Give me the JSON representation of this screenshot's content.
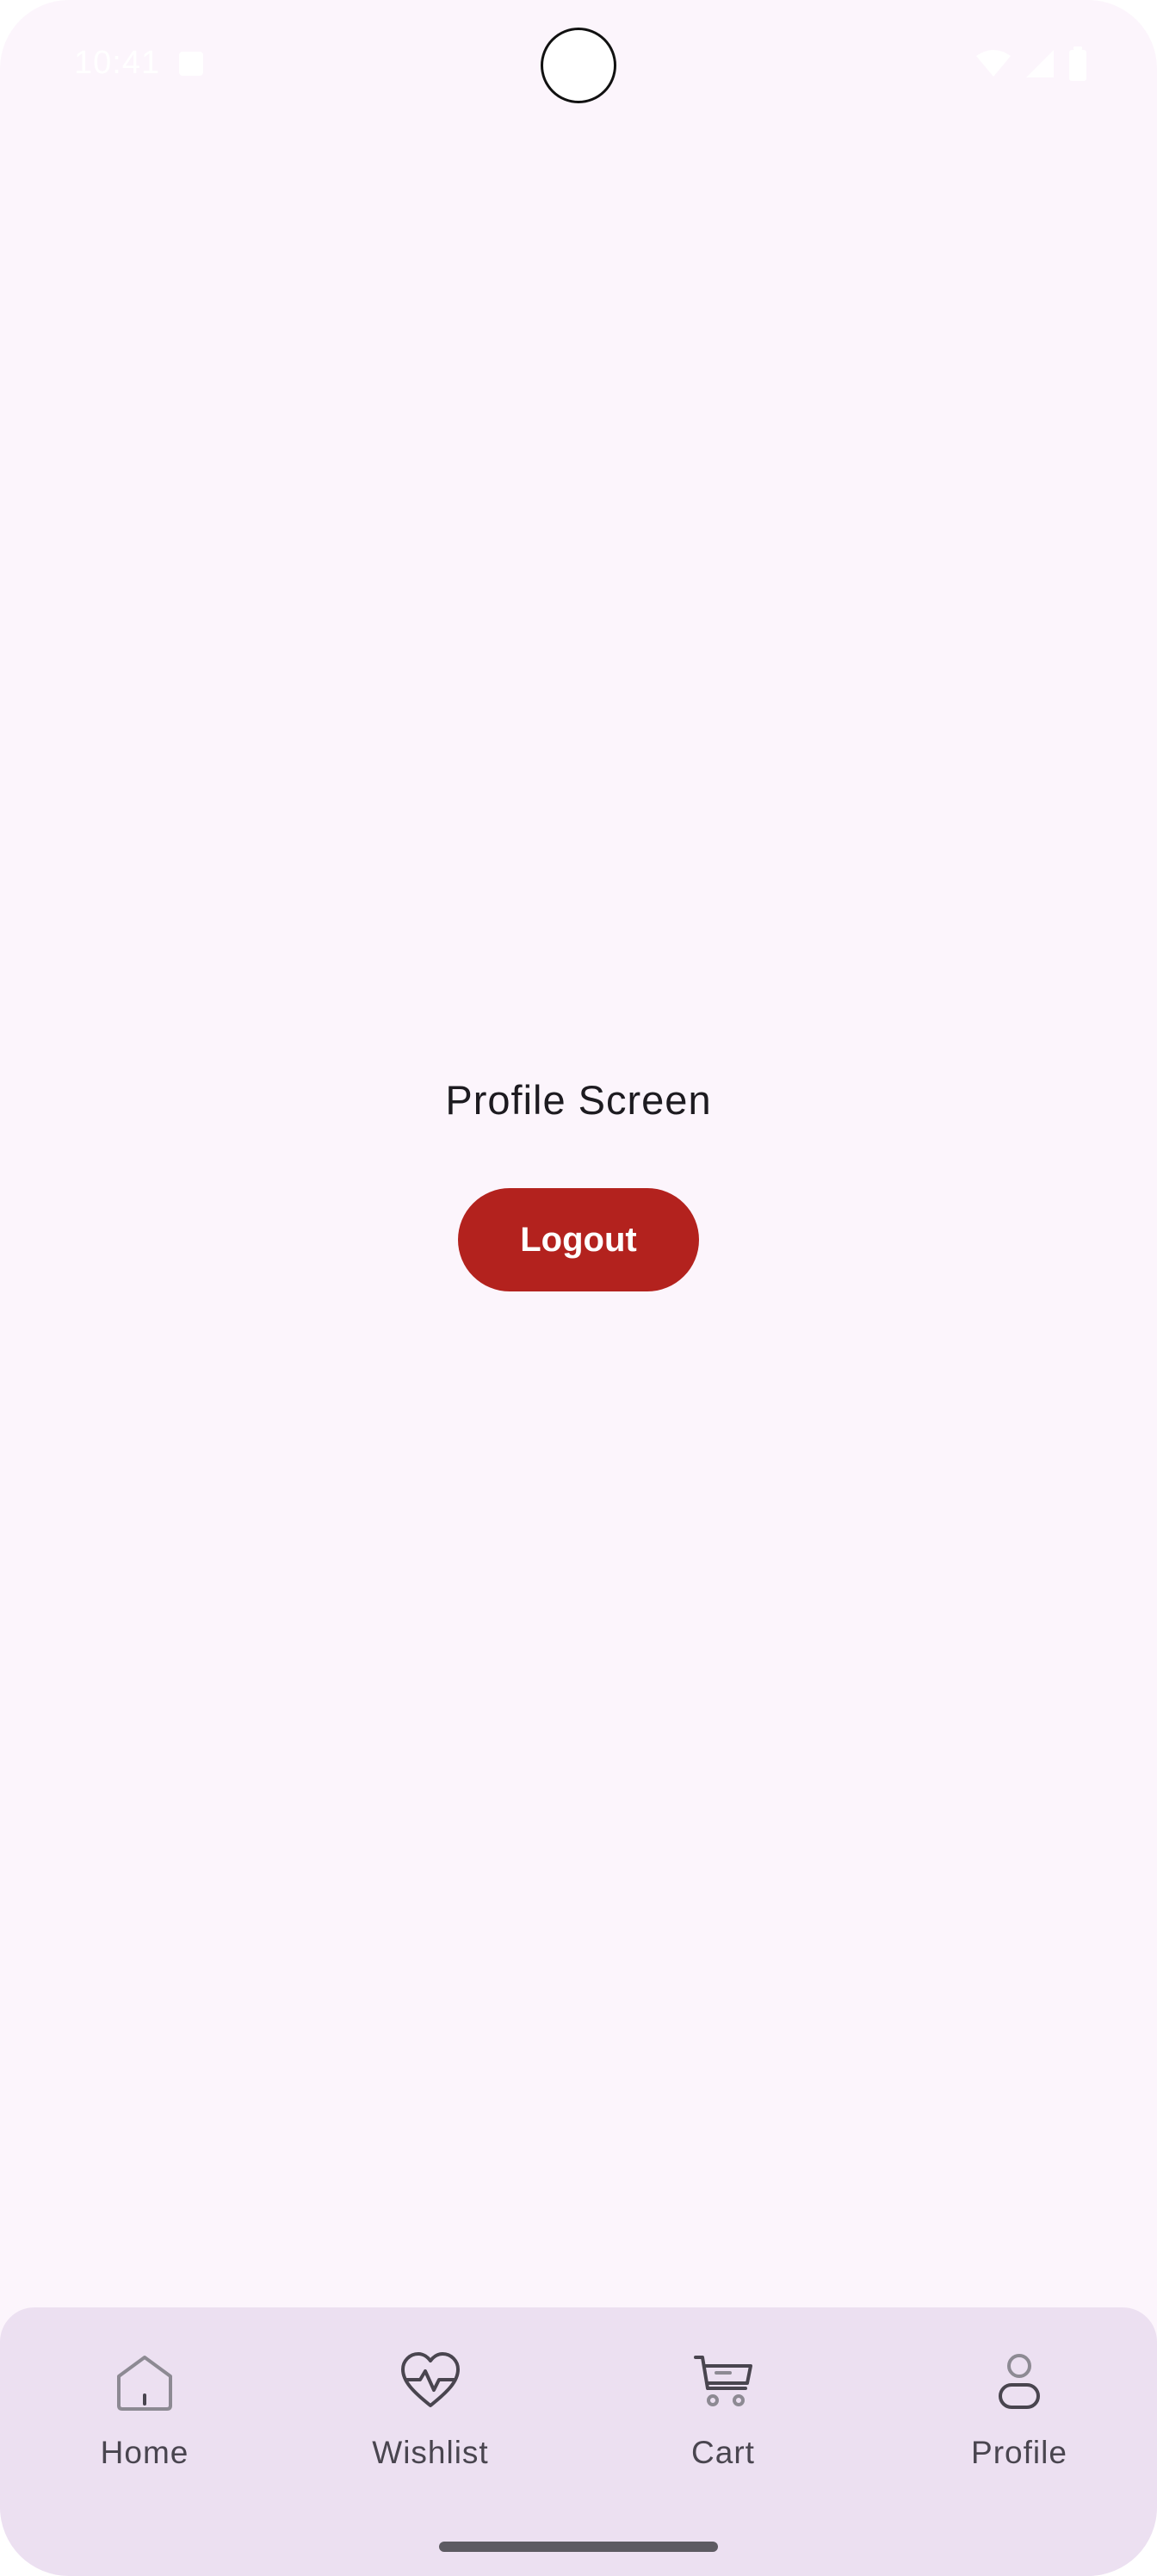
{
  "status_bar": {
    "time": "10:41"
  },
  "main": {
    "title": "Profile Screen",
    "logout_label": "Logout"
  },
  "bottom_nav": {
    "items": [
      {
        "label": "Home",
        "icon": "home-icon"
      },
      {
        "label": "Wishlist",
        "icon": "heart-pulse-icon"
      },
      {
        "label": "Cart",
        "icon": "cart-icon"
      },
      {
        "label": "Profile",
        "icon": "person-icon"
      }
    ],
    "selected": "Profile"
  },
  "colors": {
    "background": "#fcf5fc",
    "nav_background": "#ece0f1",
    "logout_button": "#b3221e",
    "text_primary": "#1d1b20",
    "nav_text": "#49454f"
  }
}
